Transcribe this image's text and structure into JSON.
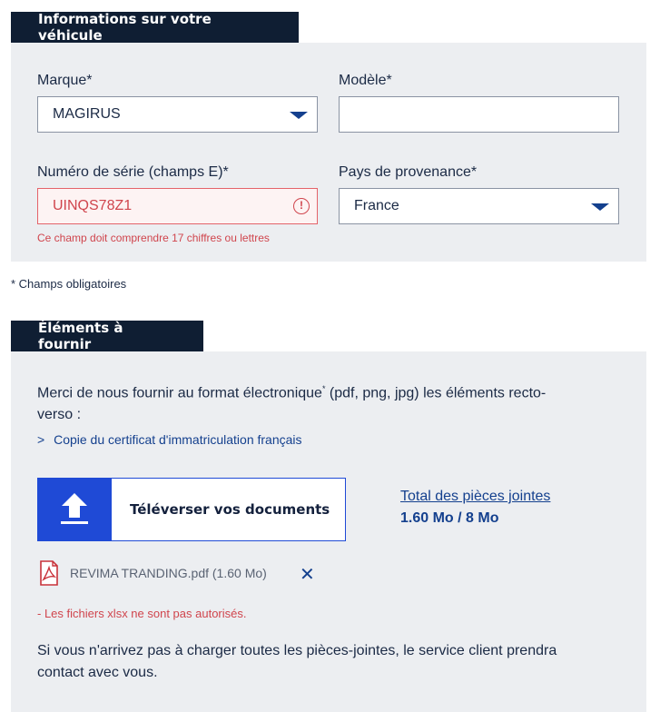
{
  "vehicle_section": {
    "title": "Informations sur votre véhicule",
    "brand": {
      "label": "Marque*",
      "value": "MAGIRUS"
    },
    "model": {
      "label": "Modèle*",
      "value": ""
    },
    "serial": {
      "label": "Numéro de série (champs E)*",
      "value": "UINQS78Z1",
      "error": "Ce champ doit comprendre 17 chiffres ou lettres"
    },
    "country": {
      "label": "Pays de provenance*",
      "value": "France"
    }
  },
  "required_note": "* Champs obligatoires",
  "documents_section": {
    "title": "Éléments à fournir",
    "intro_before_sup": "Merci de nous fournir au format électronique",
    "intro_sup": "*",
    "intro_after_sup_line1": " (pdf, png, jpg) les éléments recto-",
    "intro_line2": "verso :",
    "required_item_chevron": ">",
    "required_item": "Copie du certificat d'immatriculation français",
    "upload_button": "Téléverser vos documents",
    "total_link": "Total des pièces jointes",
    "total_value": "1.60 Mo / 8 Mo",
    "file": {
      "name": "REVIMA TRANDING.pdf (1.60 Mo)",
      "remove_glyph": "✕"
    },
    "file_warning": "- Les fichiers xlsx ne sont pas autorisés.",
    "contact_line1": "Si vous n'arrivez pas à charger toutes les pièces-jointes, le service client prendra",
    "contact_line2": "contact avec vous."
  },
  "colors": {
    "navy": "#0f1e33",
    "accent_blue": "#1f4ad6",
    "link_blue": "#14408e",
    "error_red": "#d0454d",
    "panel_gray": "#eceef1"
  }
}
